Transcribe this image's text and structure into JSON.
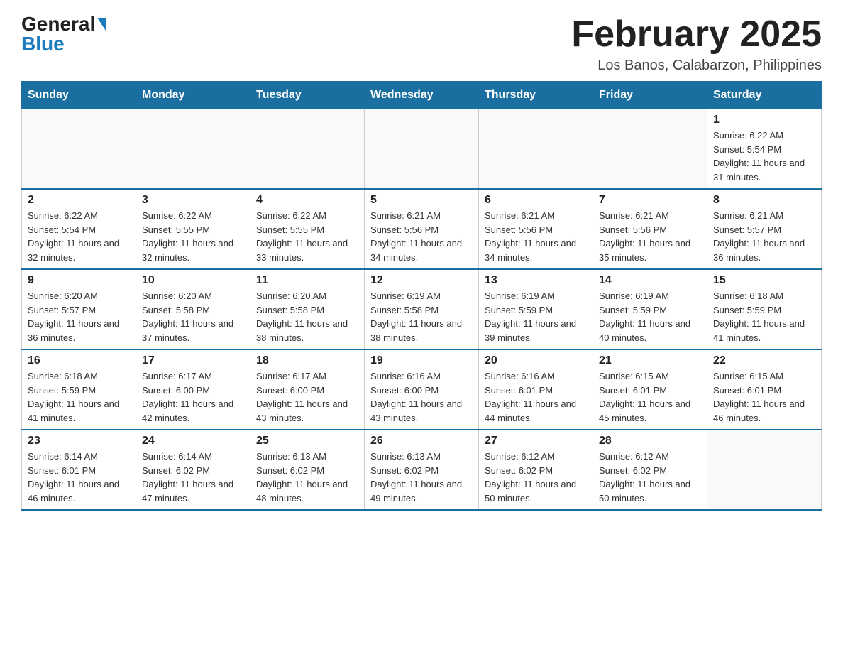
{
  "logo": {
    "general": "General",
    "blue": "Blue"
  },
  "title": {
    "month_year": "February 2025",
    "location": "Los Banos, Calabarzon, Philippines"
  },
  "weekdays": [
    "Sunday",
    "Monday",
    "Tuesday",
    "Wednesday",
    "Thursday",
    "Friday",
    "Saturday"
  ],
  "weeks": [
    [
      {
        "day": "",
        "info": ""
      },
      {
        "day": "",
        "info": ""
      },
      {
        "day": "",
        "info": ""
      },
      {
        "day": "",
        "info": ""
      },
      {
        "day": "",
        "info": ""
      },
      {
        "day": "",
        "info": ""
      },
      {
        "day": "1",
        "info": "Sunrise: 6:22 AM\nSunset: 5:54 PM\nDaylight: 11 hours and 31 minutes."
      }
    ],
    [
      {
        "day": "2",
        "info": "Sunrise: 6:22 AM\nSunset: 5:54 PM\nDaylight: 11 hours and 32 minutes."
      },
      {
        "day": "3",
        "info": "Sunrise: 6:22 AM\nSunset: 5:55 PM\nDaylight: 11 hours and 32 minutes."
      },
      {
        "day": "4",
        "info": "Sunrise: 6:22 AM\nSunset: 5:55 PM\nDaylight: 11 hours and 33 minutes."
      },
      {
        "day": "5",
        "info": "Sunrise: 6:21 AM\nSunset: 5:56 PM\nDaylight: 11 hours and 34 minutes."
      },
      {
        "day": "6",
        "info": "Sunrise: 6:21 AM\nSunset: 5:56 PM\nDaylight: 11 hours and 34 minutes."
      },
      {
        "day": "7",
        "info": "Sunrise: 6:21 AM\nSunset: 5:56 PM\nDaylight: 11 hours and 35 minutes."
      },
      {
        "day": "8",
        "info": "Sunrise: 6:21 AM\nSunset: 5:57 PM\nDaylight: 11 hours and 36 minutes."
      }
    ],
    [
      {
        "day": "9",
        "info": "Sunrise: 6:20 AM\nSunset: 5:57 PM\nDaylight: 11 hours and 36 minutes."
      },
      {
        "day": "10",
        "info": "Sunrise: 6:20 AM\nSunset: 5:58 PM\nDaylight: 11 hours and 37 minutes."
      },
      {
        "day": "11",
        "info": "Sunrise: 6:20 AM\nSunset: 5:58 PM\nDaylight: 11 hours and 38 minutes."
      },
      {
        "day": "12",
        "info": "Sunrise: 6:19 AM\nSunset: 5:58 PM\nDaylight: 11 hours and 38 minutes."
      },
      {
        "day": "13",
        "info": "Sunrise: 6:19 AM\nSunset: 5:59 PM\nDaylight: 11 hours and 39 minutes."
      },
      {
        "day": "14",
        "info": "Sunrise: 6:19 AM\nSunset: 5:59 PM\nDaylight: 11 hours and 40 minutes."
      },
      {
        "day": "15",
        "info": "Sunrise: 6:18 AM\nSunset: 5:59 PM\nDaylight: 11 hours and 41 minutes."
      }
    ],
    [
      {
        "day": "16",
        "info": "Sunrise: 6:18 AM\nSunset: 5:59 PM\nDaylight: 11 hours and 41 minutes."
      },
      {
        "day": "17",
        "info": "Sunrise: 6:17 AM\nSunset: 6:00 PM\nDaylight: 11 hours and 42 minutes."
      },
      {
        "day": "18",
        "info": "Sunrise: 6:17 AM\nSunset: 6:00 PM\nDaylight: 11 hours and 43 minutes."
      },
      {
        "day": "19",
        "info": "Sunrise: 6:16 AM\nSunset: 6:00 PM\nDaylight: 11 hours and 43 minutes."
      },
      {
        "day": "20",
        "info": "Sunrise: 6:16 AM\nSunset: 6:01 PM\nDaylight: 11 hours and 44 minutes."
      },
      {
        "day": "21",
        "info": "Sunrise: 6:15 AM\nSunset: 6:01 PM\nDaylight: 11 hours and 45 minutes."
      },
      {
        "day": "22",
        "info": "Sunrise: 6:15 AM\nSunset: 6:01 PM\nDaylight: 11 hours and 46 minutes."
      }
    ],
    [
      {
        "day": "23",
        "info": "Sunrise: 6:14 AM\nSunset: 6:01 PM\nDaylight: 11 hours and 46 minutes."
      },
      {
        "day": "24",
        "info": "Sunrise: 6:14 AM\nSunset: 6:02 PM\nDaylight: 11 hours and 47 minutes."
      },
      {
        "day": "25",
        "info": "Sunrise: 6:13 AM\nSunset: 6:02 PM\nDaylight: 11 hours and 48 minutes."
      },
      {
        "day": "26",
        "info": "Sunrise: 6:13 AM\nSunset: 6:02 PM\nDaylight: 11 hours and 49 minutes."
      },
      {
        "day": "27",
        "info": "Sunrise: 6:12 AM\nSunset: 6:02 PM\nDaylight: 11 hours and 50 minutes."
      },
      {
        "day": "28",
        "info": "Sunrise: 6:12 AM\nSunset: 6:02 PM\nDaylight: 11 hours and 50 minutes."
      },
      {
        "day": "",
        "info": ""
      }
    ]
  ]
}
